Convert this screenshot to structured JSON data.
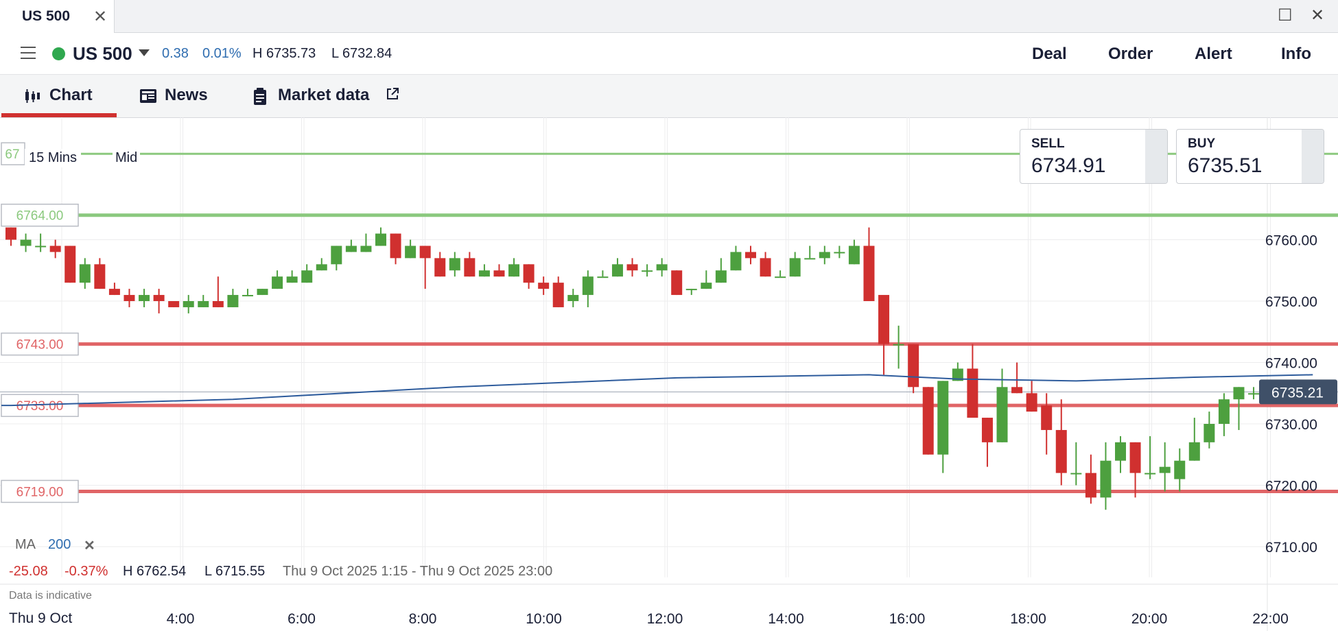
{
  "window": {
    "tab_title": "US 500",
    "close_glyph": "✕",
    "maximize_glyph": "☐",
    "window_close_glyph": "✕"
  },
  "header": {
    "instrument": "US 500",
    "change": "0.38",
    "change_pct": "0.01%",
    "high": "H 6735.73",
    "low": "L 6732.84",
    "actions": [
      "Deal",
      "Order",
      "Alert",
      "Info"
    ]
  },
  "tabs": {
    "chart": "Chart",
    "news": "News",
    "market_data": "Market data"
  },
  "prices": {
    "sell_label": "SELL",
    "sell_value": "6734.91",
    "buy_label": "BUY",
    "buy_value": "6735.51"
  },
  "chart_controls": {
    "timeframe": "15 Mins",
    "price_type": "Mid"
  },
  "indicator": {
    "name": "MA",
    "period": "200",
    "remove_glyph": "✕"
  },
  "stats": {
    "change": "-25.08",
    "change_pct": "-0.37%",
    "high": "H 6762.54",
    "low": "L 6715.55",
    "range": "Thu 9 Oct 2025 1:15 - Thu 9 Oct 2025 23:00"
  },
  "footer": {
    "indicative": "Data is indicative",
    "date": "Thu 9 Oct"
  },
  "colors": {
    "up": "#4da03f",
    "down": "#d0302f",
    "ma": "#2d5b9c",
    "green_level": "#8bc97e",
    "red_level": "#e06466",
    "current": "#3f5068"
  },
  "chart_data": {
    "type": "candlestick",
    "x_ticks": [
      "4:00",
      "6:00",
      "8:00",
      "10:00",
      "12:00",
      "14:00",
      "16:00",
      "18:00",
      "20:00",
      "22:00"
    ],
    "y_ticks": [
      "6710.00",
      "6720.00",
      "6730.00",
      "6740.00",
      "6750.00",
      "6760.00"
    ],
    "ylim": [
      6705,
      6778
    ],
    "current_price": "6735.21",
    "alert_levels": [
      {
        "label": "6764.00",
        "value": 6764,
        "kind": "green"
      },
      {
        "label": "6743.00",
        "value": 6743,
        "kind": "red"
      },
      {
        "label": "6733.00",
        "value": 6733,
        "kind": "red"
      },
      {
        "label": "6719.00",
        "value": 6719,
        "kind": "red"
      }
    ],
    "top_level": {
      "value": 6774,
      "label": "67",
      "kind": "green"
    },
    "candles": [
      [
        6762,
        6760,
        6762,
        6759
      ],
      [
        6759,
        6760,
        6761,
        6758
      ],
      [
        6759,
        6759,
        6761,
        6758
      ],
      [
        6759,
        6758,
        6760,
        6757
      ],
      [
        6759,
        6753,
        6759,
        6753
      ],
      [
        6753,
        6756,
        6757,
        6752
      ],
      [
        6756,
        6752,
        6757,
        6752
      ],
      [
        6752,
        6751,
        6753,
        6751
      ],
      [
        6751,
        6750,
        6752,
        6749
      ],
      [
        6750,
        6751,
        6752,
        6749
      ],
      [
        6751,
        6750,
        6752,
        6748
      ],
      [
        6750,
        6749,
        6750,
        6749
      ],
      [
        6749,
        6750,
        6751,
        6748
      ],
      [
        6749,
        6750,
        6751,
        6749
      ],
      [
        6750,
        6749,
        6754,
        6749
      ],
      [
        6749,
        6751,
        6752,
        6749
      ],
      [
        6751,
        6751,
        6752,
        6751
      ],
      [
        6751,
        6752,
        6752,
        6751
      ],
      [
        6752,
        6754,
        6755,
        6752
      ],
      [
        6753,
        6754,
        6755,
        6753
      ],
      [
        6753,
        6755,
        6756,
        6753
      ],
      [
        6755,
        6756,
        6757,
        6755
      ],
      [
        6756,
        6759,
        6759,
        6755
      ],
      [
        6758,
        6759,
        6760,
        6758
      ],
      [
        6758,
        6759,
        6761,
        6758
      ],
      [
        6759,
        6761,
        6762,
        6759
      ],
      [
        6761,
        6757,
        6761,
        6756
      ],
      [
        6757,
        6759,
        6760,
        6757
      ],
      [
        6759,
        6757,
        6759,
        6752
      ],
      [
        6757,
        6754,
        6758,
        6754
      ],
      [
        6755,
        6757,
        6758,
        6754
      ],
      [
        6757,
        6754,
        6758,
        6754
      ],
      [
        6754,
        6755,
        6756,
        6754
      ],
      [
        6755,
        6754,
        6756,
        6754
      ],
      [
        6754,
        6756,
        6757,
        6754
      ],
      [
        6756,
        6753,
        6756,
        6752
      ],
      [
        6753,
        6752,
        6754,
        6751
      ],
      [
        6753,
        6749,
        6754,
        6749
      ],
      [
        6750,
        6751,
        6752,
        6749
      ],
      [
        6751,
        6754,
        6755,
        6749
      ],
      [
        6754,
        6754,
        6755,
        6754
      ],
      [
        6754,
        6756,
        6757,
        6754
      ],
      [
        6756,
        6755,
        6757,
        6754
      ],
      [
        6755,
        6755,
        6756,
        6754
      ],
      [
        6755,
        6756,
        6757,
        6754
      ],
      [
        6755,
        6751,
        6755,
        6751
      ],
      [
        6752,
        6752,
        6752,
        6751
      ],
      [
        6752,
        6753,
        6755,
        6752
      ],
      [
        6753,
        6755,
        6757,
        6753
      ],
      [
        6755,
        6758,
        6759,
        6755
      ],
      [
        6758,
        6757,
        6759,
        6756
      ],
      [
        6757,
        6754,
        6758,
        6754
      ],
      [
        6754,
        6754,
        6755,
        6754
      ],
      [
        6754,
        6757,
        6758,
        6754
      ],
      [
        6757,
        6757,
        6759,
        6757
      ],
      [
        6757,
        6758,
        6759,
        6756
      ],
      [
        6758,
        6758,
        6759,
        6757
      ],
      [
        6756,
        6759,
        6760,
        6756
      ],
      [
        6759,
        6750,
        6762,
        6750
      ],
      [
        6751,
        6743,
        6746,
        6738
      ],
      [
        6743,
        6743,
        6746,
        6739
      ],
      [
        6743,
        6736,
        6743,
        6735
      ],
      [
        6736,
        6725,
        6736,
        6725
      ],
      [
        6725,
        6737,
        6737,
        6722
      ],
      [
        6737,
        6739,
        6740,
        6737
      ],
      [
        6739,
        6731,
        6743,
        6731
      ],
      [
        6731,
        6727,
        6731,
        6723
      ],
      [
        6727,
        6736,
        6739,
        6727
      ],
      [
        6736,
        6735,
        6740,
        6735
      ],
      [
        6735,
        6732,
        6737,
        6732
      ],
      [
        6733,
        6729,
        6735,
        6725
      ],
      [
        6729,
        6722,
        6734,
        6720
      ],
      [
        6722,
        6722,
        6727,
        6720
      ],
      [
        6722,
        6718,
        6725,
        6717
      ],
      [
        6718,
        6724,
        6727,
        6716
      ],
      [
        6724,
        6727,
        6728,
        6722
      ],
      [
        6727,
        6722,
        6727,
        6718
      ],
      [
        6722,
        6722,
        6728,
        6721
      ],
      [
        6722,
        6723,
        6727,
        6719
      ],
      [
        6721,
        6724,
        6726,
        6719
      ],
      [
        6724,
        6727,
        6731,
        6724
      ],
      [
        6727,
        6730,
        6732,
        6726
      ],
      [
        6730,
        6734,
        6735,
        6728
      ],
      [
        6734,
        6736,
        6736,
        6729
      ],
      [
        6735,
        6735,
        6736,
        6734
      ]
    ],
    "ma200": [
      [
        0,
        6733
      ],
      [
        15,
        6734
      ],
      [
        30,
        6736
      ],
      [
        45,
        6737.5
      ],
      [
        58,
        6738
      ],
      [
        64,
        6737.3
      ],
      [
        72,
        6737
      ],
      [
        80,
        6737.6
      ],
      [
        88,
        6738
      ]
    ]
  }
}
